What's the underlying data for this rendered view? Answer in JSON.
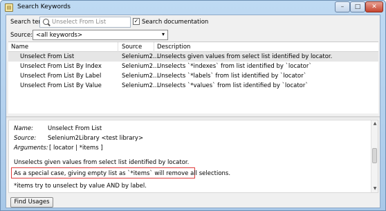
{
  "window": {
    "title": "Search Keywords",
    "app_icon": "document-icon",
    "minimize": "–",
    "maximize": "□",
    "close": "✕"
  },
  "search": {
    "label": "Search term:",
    "placeholder": "Unselect From List",
    "doc_checkbox_checked": true,
    "doc_checkbox_mark": "✓",
    "doc_checkbox_label": "Search documentation"
  },
  "source": {
    "label": "Source:",
    "value": "<all keywords>",
    "arrow": "▾"
  },
  "table": {
    "columns": [
      "Name",
      "Source",
      "Description"
    ],
    "rows": [
      {
        "name": "Unselect From List",
        "source": "Selenium2...",
        "description": "Unselects given values from select list identified by locator.",
        "selected": true
      },
      {
        "name": "Unselect From List By Index",
        "source": "Selenium2...",
        "description": "Unselects `*indexes` from list identified by `locator`",
        "selected": false
      },
      {
        "name": "Unselect From List By Label",
        "source": "Selenium2...",
        "description": "Unselects `*labels` from list identified by `locator`",
        "selected": false
      },
      {
        "name": "Unselect From List By Value",
        "source": "Selenium2...",
        "description": "Unselects `*values` from list identified by `locator`",
        "selected": false
      }
    ]
  },
  "details": {
    "name_key": "Name:",
    "name_value": "Unselect From List",
    "source_key": "Source:",
    "source_value": "Selenium2Library <test library>",
    "arguments_key": "Arguments:",
    "arguments_value": "[ locator | *items ]",
    "line1": "Unselects given values from select list identified by locator.",
    "line2": "As a special case, giving empty list as `*items` will remove all selections.",
    "line3": "*items try to unselect by value AND by label.",
    "highlight_color": "#e03a3a"
  },
  "footer": {
    "find_usages_label": "Find Usages"
  }
}
